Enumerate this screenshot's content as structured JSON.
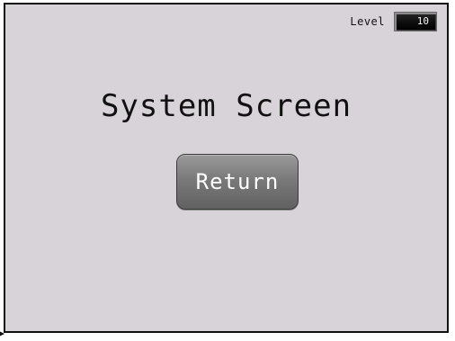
{
  "screen": {
    "title": "System Screen",
    "return_label": "Return"
  },
  "level": {
    "label": "Level",
    "value": "10"
  },
  "colors": {
    "background": "#d7d3d8",
    "button": "#7a7a7a",
    "display": "#000000"
  }
}
